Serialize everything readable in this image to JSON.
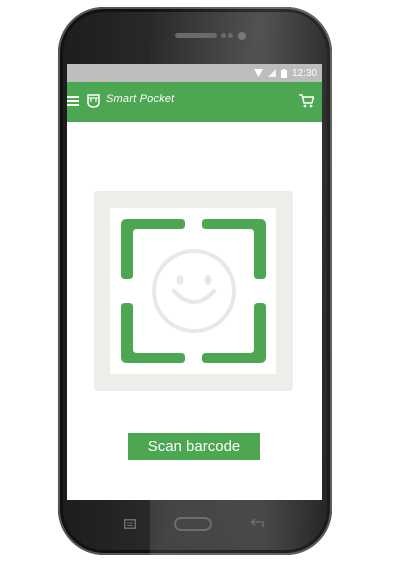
{
  "status_bar": {
    "time": "12:30"
  },
  "app_bar": {
    "title": "Smart Pocket",
    "menu_icon": "hamburger-menu-icon",
    "logo_icon": "pocket-logo-icon",
    "cart_icon": "shopping-cart-icon"
  },
  "main": {
    "scanner_icon": "smiley-face-icon",
    "scan_button_label": "Scan barcode"
  },
  "nav_bar": {
    "recent_icon": "recent-apps-icon",
    "home_icon": "home-button-icon",
    "back_icon": "back-arrow-icon"
  },
  "colors": {
    "accent": "#4ca652",
    "status_bar": "#bdbdbd",
    "scanner_background": "#efede9",
    "phone_body": "#2b2b2b"
  }
}
